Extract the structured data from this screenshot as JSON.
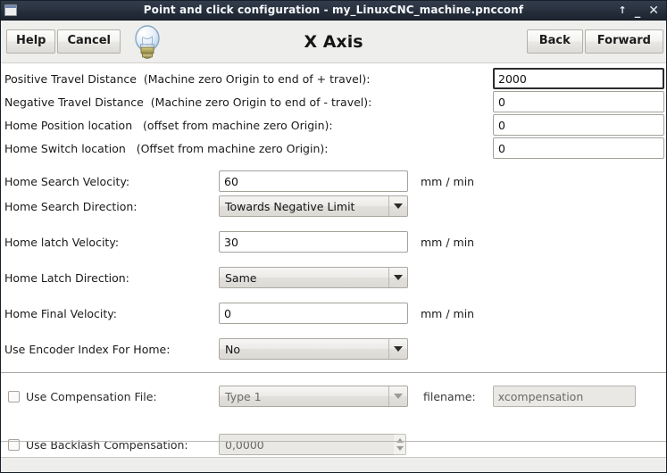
{
  "window": {
    "title": "Point and click configuration - my_LinuxCNC_machine.pncconf",
    "icon": "window-icon",
    "controls": {
      "shade": "↑",
      "minimize": "_",
      "close": "✕"
    }
  },
  "toolbar": {
    "help_label": "Help",
    "cancel_label": "Cancel",
    "bulb_icon": "lightbulb-icon",
    "page_title": "X Axis",
    "back_label": "Back",
    "forward_label": "Forward"
  },
  "travel": {
    "rows": [
      {
        "label": "Positive Travel Distance  (Machine zero Origin to end of + travel):",
        "value": "2000",
        "focused": true
      },
      {
        "label": "Negative Travel Distance  (Machine zero Origin to end of - travel):",
        "value": "0",
        "focused": false
      },
      {
        "label": "Home Position location   (offset from machine zero Origin):",
        "value": "0",
        "focused": false
      },
      {
        "label": "Home Switch location   (Offset from machine zero Origin):",
        "value": "0",
        "focused": false
      }
    ]
  },
  "homing": {
    "search_velocity": {
      "label": "Home Search Velocity:",
      "value": "60",
      "unit": "mm / min"
    },
    "search_direction": {
      "label": "Home Search Direction:",
      "value": "Towards Negative Limit"
    },
    "latch_velocity": {
      "label": "Home latch Velocity:",
      "value": "30",
      "unit": "mm / min"
    },
    "latch_direction": {
      "label": "Home Latch Direction:",
      "value": "Same"
    },
    "final_velocity": {
      "label": "Home Final Velocity:",
      "value": "0",
      "unit": "mm / min"
    },
    "encoder_index": {
      "label": "Use Encoder Index For Home:",
      "value": "No"
    }
  },
  "compensation": {
    "use_comp_file": {
      "label": "Use Compensation File:",
      "checked": false,
      "type_value": "Type 1",
      "filename_label": "filename:",
      "filename_value": "xcompensation"
    },
    "use_backlash": {
      "label": "Use Backlash Compensation:",
      "checked": false,
      "value": "0,0000"
    }
  }
}
